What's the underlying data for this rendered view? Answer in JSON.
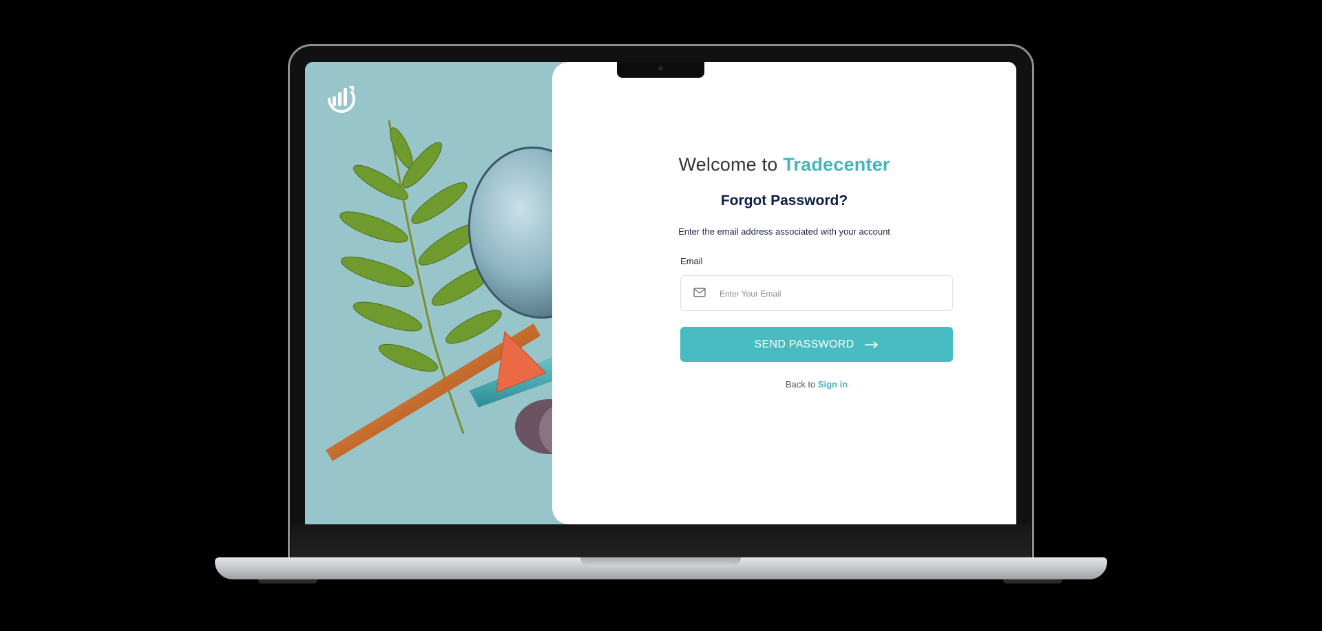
{
  "app": {
    "brand_name": "Tradecenter",
    "welcome_prefix": "Welcome to",
    "logo_icon": "chart-growth-logo-icon"
  },
  "form": {
    "title": "Forgot Password?",
    "instructions": "Enter the email address associated with your account",
    "email_label": "Email",
    "email_placeholder": "Enter Your Email",
    "email_value": "",
    "email_icon": "mail-icon",
    "submit_label": "SEND PASSWORD",
    "submit_icon": "arrow-right-icon",
    "back_prefix": "Back to",
    "back_link": "Sign in"
  },
  "colors": {
    "accent": "#49bcc1",
    "panel_background": "#98c5c9",
    "title_navy": "#0f1d49"
  }
}
